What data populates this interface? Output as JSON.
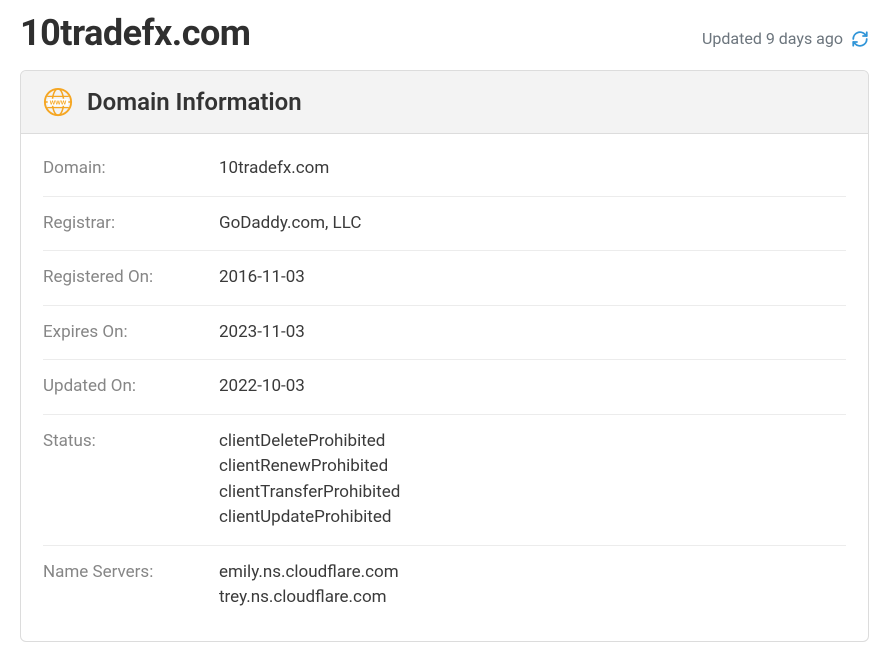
{
  "header": {
    "domain_title": "10tradefx.com",
    "updated_text": "Updated 9 days ago"
  },
  "card": {
    "title": "Domain Information"
  },
  "labels": {
    "domain": "Domain:",
    "registrar": "Registrar:",
    "registered_on": "Registered On:",
    "expires_on": "Expires On:",
    "updated_on": "Updated On:",
    "status": "Status:",
    "name_servers": "Name Servers:"
  },
  "info": {
    "domain": "10tradefx.com",
    "registrar": "GoDaddy.com, LLC",
    "registered_on": "2016-11-03",
    "expires_on": "2023-11-03",
    "updated_on": "2022-10-03",
    "status": [
      "clientDeleteProhibited",
      "clientRenewProhibited",
      "clientTransferProhibited",
      "clientUpdateProhibited"
    ],
    "name_servers": [
      "emily.ns.cloudflare.com",
      "trey.ns.cloudflare.com"
    ]
  }
}
